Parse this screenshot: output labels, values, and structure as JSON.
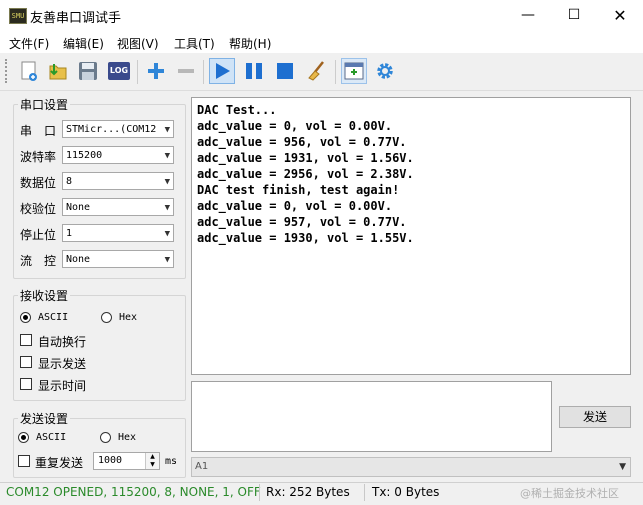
{
  "window": {
    "title": "友善串口调试手"
  },
  "menu": [
    "文件(F)",
    "编辑(E)",
    "视图(V)",
    "工具(T)",
    "帮助(H)"
  ],
  "toolbar": {
    "log_label": "LOG"
  },
  "serial": {
    "group_title": "串口设置",
    "port_label": "串　口",
    "port_value": "STMicr...(COM12",
    "baud_label": "波特率",
    "baud_value": "115200",
    "databits_label": "数据位",
    "databits_value": "8",
    "parity_label": "校验位",
    "parity_value": "None",
    "stopbits_label": "停止位",
    "stopbits_value": "1",
    "flow_label": "流　控",
    "flow_value": "None"
  },
  "recv_settings": {
    "group_title": "接收设置",
    "ascii_label": "ASCII",
    "hex_label": "Hex",
    "mode_selected": "ASCII",
    "auto_wrap_label": "自动换行",
    "show_send_label": "显示发送",
    "show_time_label": "显示时间"
  },
  "send_settings": {
    "group_title": "发送设置",
    "ascii_label": "ASCII",
    "hex_label": "Hex",
    "mode_selected": "ASCII",
    "repeat_label": "重复发送",
    "interval_value": "1000",
    "unit_label": "ms",
    "send_button": "发送"
  },
  "receive_text": "DAC Test...\nadc_value = 0, vol = 0.00V.\nadc_value = 956, vol = 0.77V.\nadc_value = 1931, vol = 1.56V.\nadc_value = 2956, vol = 2.38V.\nDAC test finish, test again!\nadc_value = 0, vol = 0.00V.\nadc_value = 957, vol = 0.77V.\nadc_value = 1930, vol = 1.55V.",
  "send_text": "",
  "history_value": "A1",
  "status": {
    "port_status": "COM12 OPENED, 115200, 8, NONE, 1, OFF",
    "rx": "Rx: 252 Bytes",
    "tx": "Tx: 0 Bytes",
    "watermark": "@稀土掘金技术社区"
  },
  "colors": {
    "status_green": "#2a8a2a",
    "play_blue": "#1e6fd0",
    "accent_blue": "#2f86d8"
  }
}
